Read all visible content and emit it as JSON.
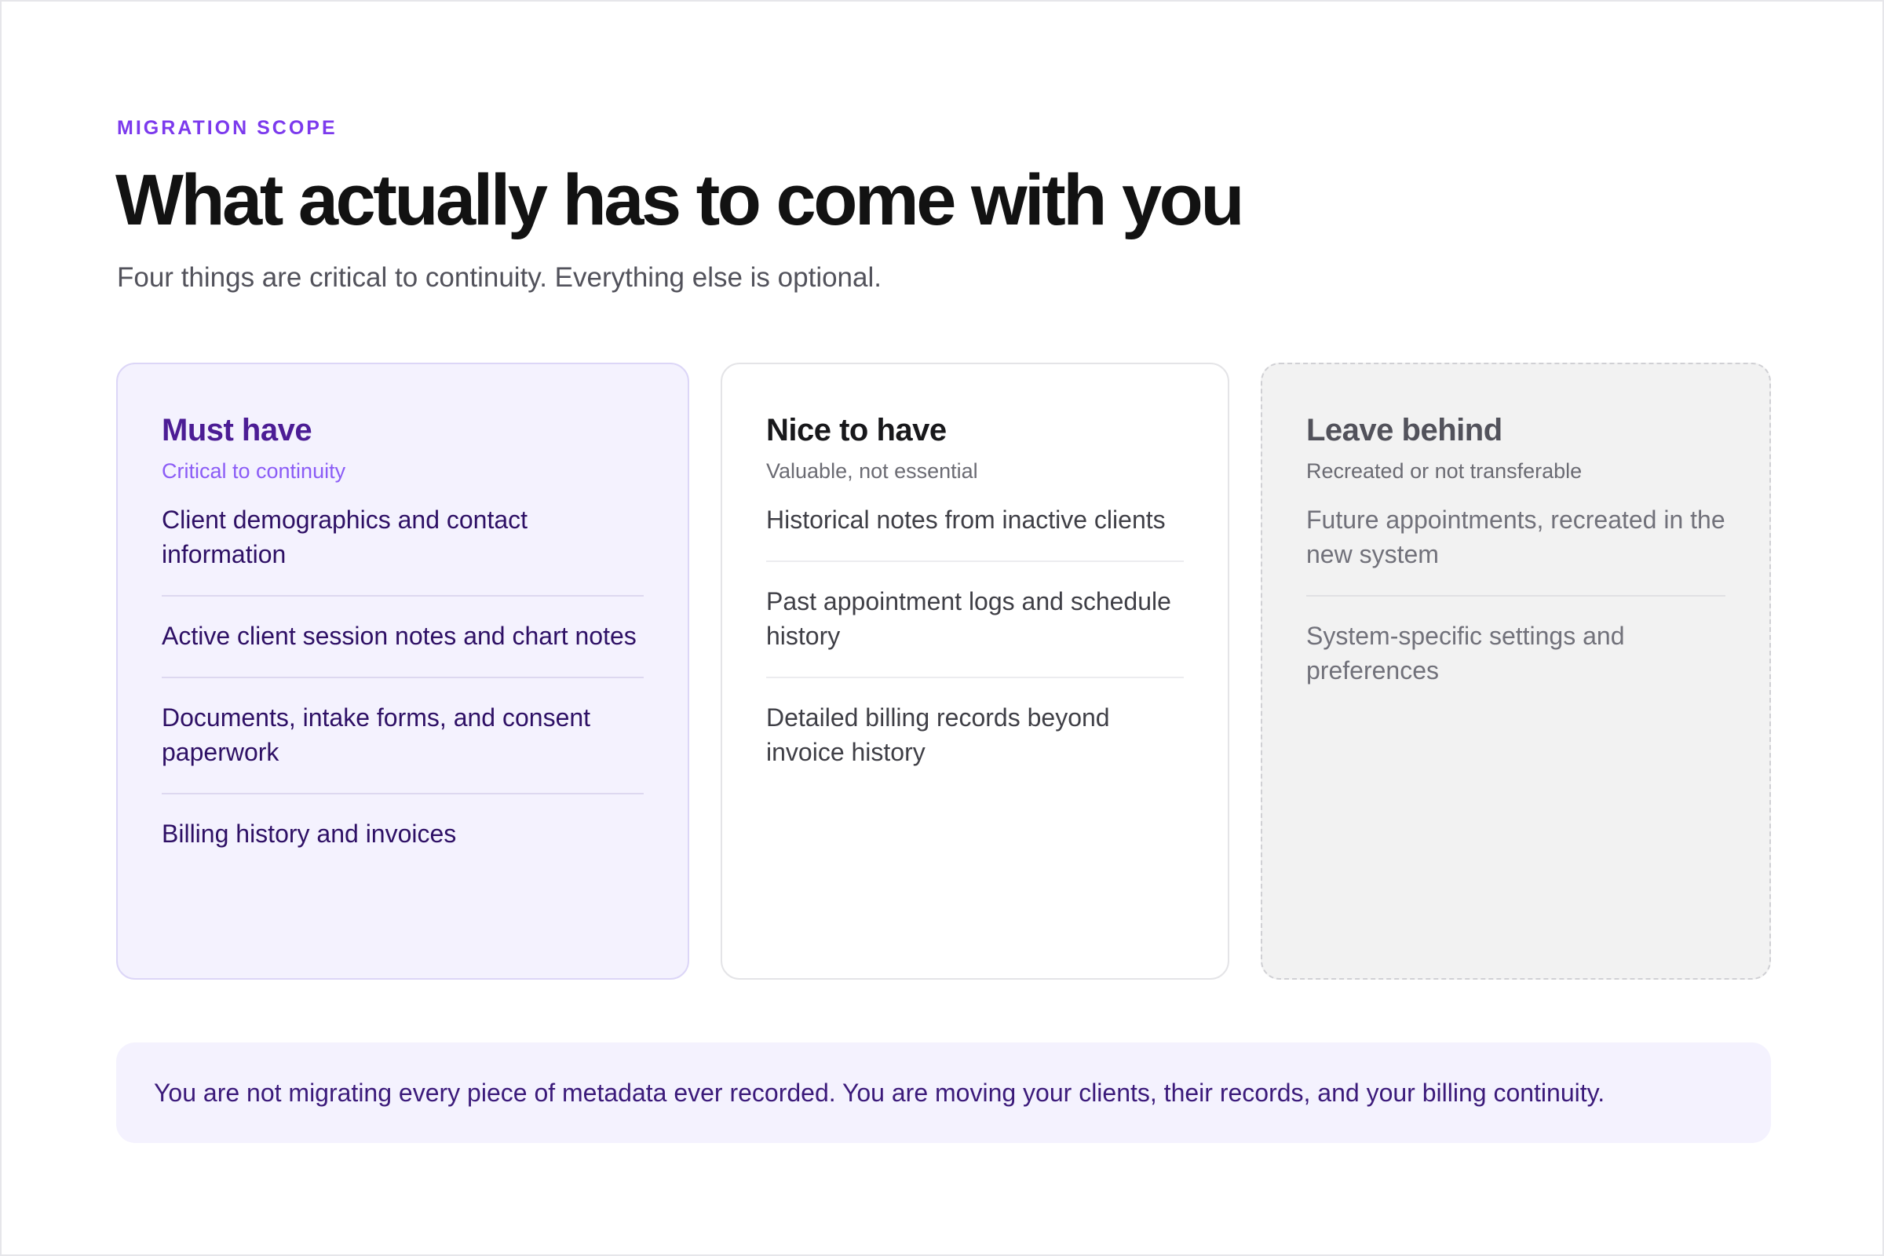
{
  "header": {
    "eyebrow": "MIGRATION SCOPE",
    "title": "What actually has to come with you",
    "subtitle": "Four things are critical to continuity. Everything else is optional."
  },
  "cards": [
    {
      "title": "Must have",
      "subtitle": "Critical to continuity",
      "items": [
        "Client demographics and contact information",
        "Active client session notes and chart notes",
        "Documents, intake forms, and consent paperwork",
        "Billing history and invoices"
      ]
    },
    {
      "title": "Nice to have",
      "subtitle": "Valuable, not essential",
      "items": [
        "Historical notes from inactive clients",
        "Past appointment logs and schedule history",
        "Detailed billing records beyond invoice history"
      ]
    },
    {
      "title": "Leave behind",
      "subtitle": "Recreated or not transferable",
      "items": [
        "Future appointments, recreated in the new system",
        "System-specific settings and preferences"
      ]
    }
  ],
  "footer": {
    "note": "You are not migrating every piece of metadata ever recorded. You are moving your clients, their records, and your billing continuity."
  },
  "colors": {
    "accent": "#7c3aed",
    "must_bg": "#f4f2fe",
    "leave_bg": "#f2f2f2"
  }
}
